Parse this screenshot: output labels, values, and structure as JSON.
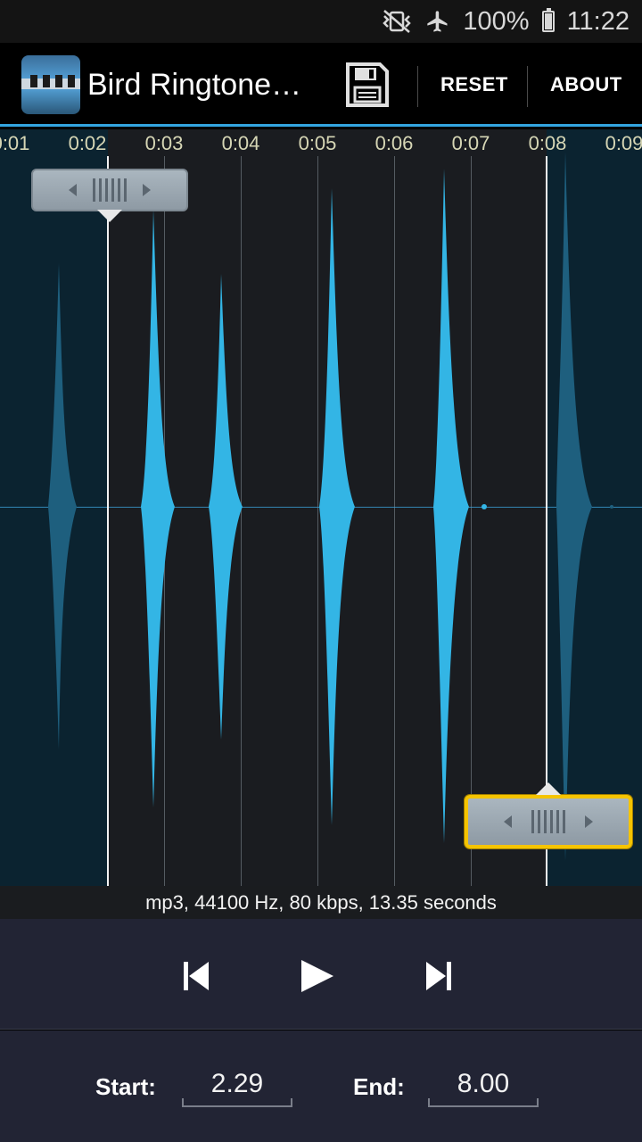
{
  "status": {
    "battery": "100%",
    "time": "11:22",
    "icons": [
      "vibrate-off-icon",
      "airplane-icon",
      "battery-icon"
    ]
  },
  "actionbar": {
    "title": "Bird Ringtone…",
    "save_icon": "floppy-disk-icon",
    "reset_label": "RESET",
    "about_label": "ABOUT"
  },
  "waveform": {
    "time_labels": [
      "0:01",
      "0:02",
      "0:03",
      "0:04",
      "0:05",
      "0:06",
      "0:07",
      "0:08",
      "0:09"
    ],
    "start_marker": "2.29",
    "end_marker": "8.00",
    "colors": {
      "wave_selected": "#33b5e5",
      "wave_unselected": "#1e5f7e",
      "bg_selected": "#1a1c20",
      "bg_unselected": "#0b2330",
      "active_handle": "#f5c400"
    }
  },
  "info": {
    "text": "mp3, 44100 Hz, 80 kbps, 13.35 seconds"
  },
  "transport": {
    "prev_icon": "skip-previous-icon",
    "play_icon": "play-icon",
    "next_icon": "skip-next-icon"
  },
  "bounds": {
    "start_label": "Start:",
    "start_value": "2.29",
    "end_label": "End:",
    "end_value": "8.00"
  }
}
